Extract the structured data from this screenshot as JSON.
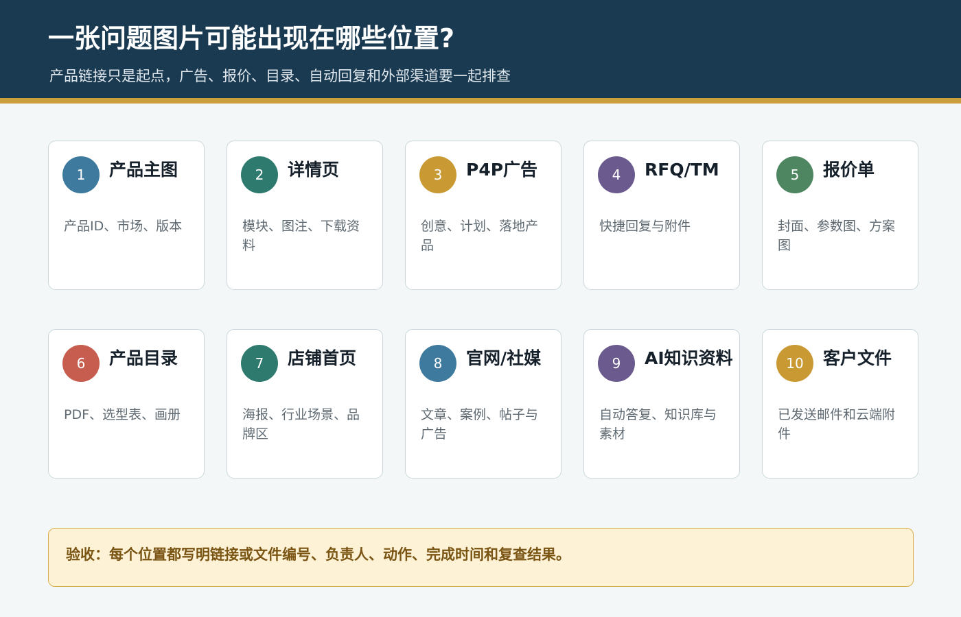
{
  "header": {
    "title": "一张问题图片可能出现在哪些位置?",
    "subtitle": "产品链接只是起点，广告、报价、目录、自动回复和外部渠道要一起排查"
  },
  "cards": [
    {
      "number": "1",
      "title": "产品主图",
      "desc": "产品ID、市场、版本",
      "color": "#3d7a9e"
    },
    {
      "number": "2",
      "title": "详情页",
      "desc": "模块、图注、下载资料",
      "color": "#2e7a6e"
    },
    {
      "number": "3",
      "title": "P4P广告",
      "desc": "创意、计划、落地产品",
      "color": "#c99a34"
    },
    {
      "number": "4",
      "title": "RFQ/TM",
      "desc": "快捷回复与附件",
      "color": "#6b5a8e"
    },
    {
      "number": "5",
      "title": "报价单",
      "desc": "封面、参数图、方案图",
      "color": "#4d8660"
    },
    {
      "number": "6",
      "title": "产品目录",
      "desc": "PDF、选型表、画册",
      "color": "#c65d4e"
    },
    {
      "number": "7",
      "title": "店铺首页",
      "desc": "海报、行业场景、品牌区",
      "color": "#2e7a6e"
    },
    {
      "number": "8",
      "title": "官网/社媒",
      "desc": "文章、案例、帖子与广告",
      "color": "#3d7a9e"
    },
    {
      "number": "9",
      "title": "AI知识资料",
      "desc": "自动答复、知识库与素材",
      "color": "#6b5a8e"
    },
    {
      "number": "10",
      "title": "客户文件",
      "desc": "已发送邮件和云端附件",
      "color": "#c99a34"
    }
  ],
  "note": {
    "text": "验收：每个位置都写明链接或文件编号、负责人、动作、完成时间和复查结果。"
  }
}
